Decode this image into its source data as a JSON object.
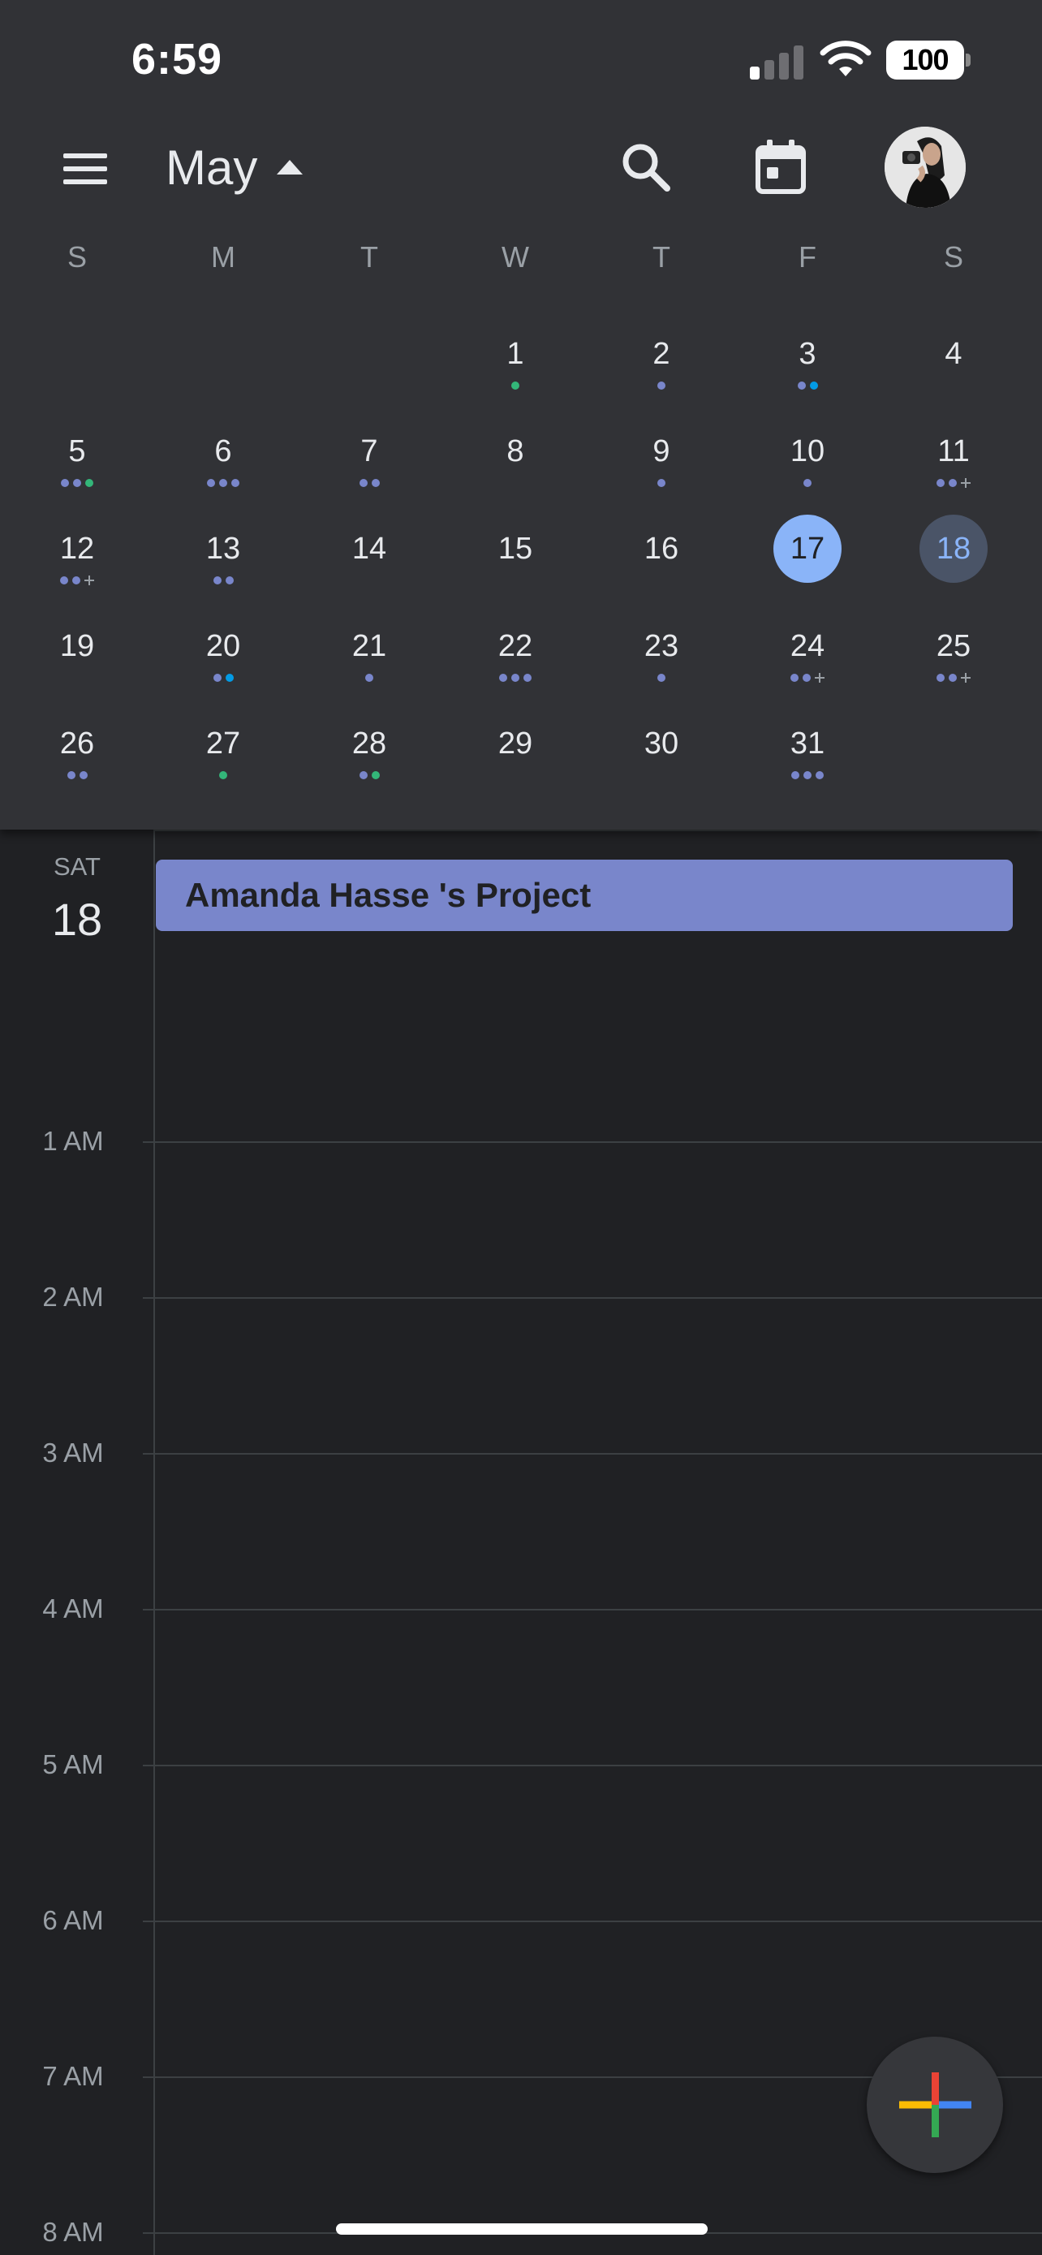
{
  "status_bar": {
    "time": "6:59",
    "battery": "100"
  },
  "header": {
    "month": "May"
  },
  "weekdays": [
    "S",
    "M",
    "T",
    "W",
    "T",
    "F",
    "S"
  ],
  "month_days": [
    {
      "day": "1",
      "col": 3,
      "row": 0,
      "dots": [
        "teal"
      ]
    },
    {
      "day": "2",
      "col": 4,
      "row": 0,
      "dots": [
        "lavender"
      ]
    },
    {
      "day": "3",
      "col": 5,
      "row": 0,
      "dots": [
        "lavender",
        "blue"
      ]
    },
    {
      "day": "4",
      "col": 6,
      "row": 0,
      "dots": []
    },
    {
      "day": "5",
      "col": 0,
      "row": 1,
      "dots": [
        "lavender",
        "lavender",
        "teal"
      ]
    },
    {
      "day": "6",
      "col": 1,
      "row": 1,
      "dots": [
        "lavender",
        "lavender",
        "lavender"
      ]
    },
    {
      "day": "7",
      "col": 2,
      "row": 1,
      "dots": [
        "lavender",
        "lavender"
      ]
    },
    {
      "day": "8",
      "col": 3,
      "row": 1,
      "dots": []
    },
    {
      "day": "9",
      "col": 4,
      "row": 1,
      "dots": [
        "lavender"
      ]
    },
    {
      "day": "10",
      "col": 5,
      "row": 1,
      "dots": [
        "lavender"
      ]
    },
    {
      "day": "11",
      "col": 6,
      "row": 1,
      "dots": [
        "lavender",
        "lavender",
        "plus"
      ]
    },
    {
      "day": "12",
      "col": 0,
      "row": 2,
      "dots": [
        "lavender",
        "lavender",
        "plus"
      ]
    },
    {
      "day": "13",
      "col": 1,
      "row": 2,
      "dots": [
        "lavender",
        "lavender"
      ]
    },
    {
      "day": "14",
      "col": 2,
      "row": 2,
      "dots": []
    },
    {
      "day": "15",
      "col": 3,
      "row": 2,
      "dots": []
    },
    {
      "day": "16",
      "col": 4,
      "row": 2,
      "dots": []
    },
    {
      "day": "17",
      "col": 5,
      "row": 2,
      "dots": [],
      "state": "today"
    },
    {
      "day": "18",
      "col": 6,
      "row": 2,
      "dots": [],
      "state": "selected"
    },
    {
      "day": "19",
      "col": 0,
      "row": 3,
      "dots": []
    },
    {
      "day": "20",
      "col": 1,
      "row": 3,
      "dots": [
        "lavender",
        "blue"
      ]
    },
    {
      "day": "21",
      "col": 2,
      "row": 3,
      "dots": [
        "lavender"
      ]
    },
    {
      "day": "22",
      "col": 3,
      "row": 3,
      "dots": [
        "lavender",
        "lavender",
        "lavender"
      ]
    },
    {
      "day": "23",
      "col": 4,
      "row": 3,
      "dots": [
        "lavender"
      ]
    },
    {
      "day": "24",
      "col": 5,
      "row": 3,
      "dots": [
        "lavender",
        "lavender",
        "plus"
      ]
    },
    {
      "day": "25",
      "col": 6,
      "row": 3,
      "dots": [
        "lavender",
        "lavender",
        "plus"
      ]
    },
    {
      "day": "26",
      "col": 0,
      "row": 4,
      "dots": [
        "lavender",
        "lavender"
      ]
    },
    {
      "day": "27",
      "col": 1,
      "row": 4,
      "dots": [
        "teal"
      ]
    },
    {
      "day": "28",
      "col": 2,
      "row": 4,
      "dots": [
        "lavender",
        "teal"
      ]
    },
    {
      "day": "29",
      "col": 3,
      "row": 4,
      "dots": []
    },
    {
      "day": "30",
      "col": 4,
      "row": 4,
      "dots": []
    },
    {
      "day": "31",
      "col": 5,
      "row": 4,
      "dots": [
        "lavender",
        "lavender",
        "lavender"
      ]
    }
  ],
  "dot_colors": {
    "lavender": "#7986cb",
    "teal": "#33b679",
    "blue": "#039be5"
  },
  "schedule": {
    "day_of_week": "SAT",
    "date": "18",
    "event": {
      "title": "Amanda Hasse 's Project",
      "color": "#7986cb"
    },
    "hours": [
      "1 AM",
      "2 AM",
      "3 AM",
      "4 AM",
      "5 AM",
      "6 AM",
      "7 AM",
      "8 AM"
    ]
  },
  "icons": {
    "menu": "hamburger-icon",
    "month_toggle": "caret-up-icon",
    "search": "search-icon",
    "today": "calendar-today-icon",
    "fab": "plus-icon"
  },
  "colors": {
    "panel_bg": "#313236",
    "page_bg": "#202124",
    "today": "#8ab4f8",
    "selected": "#4a5467"
  }
}
